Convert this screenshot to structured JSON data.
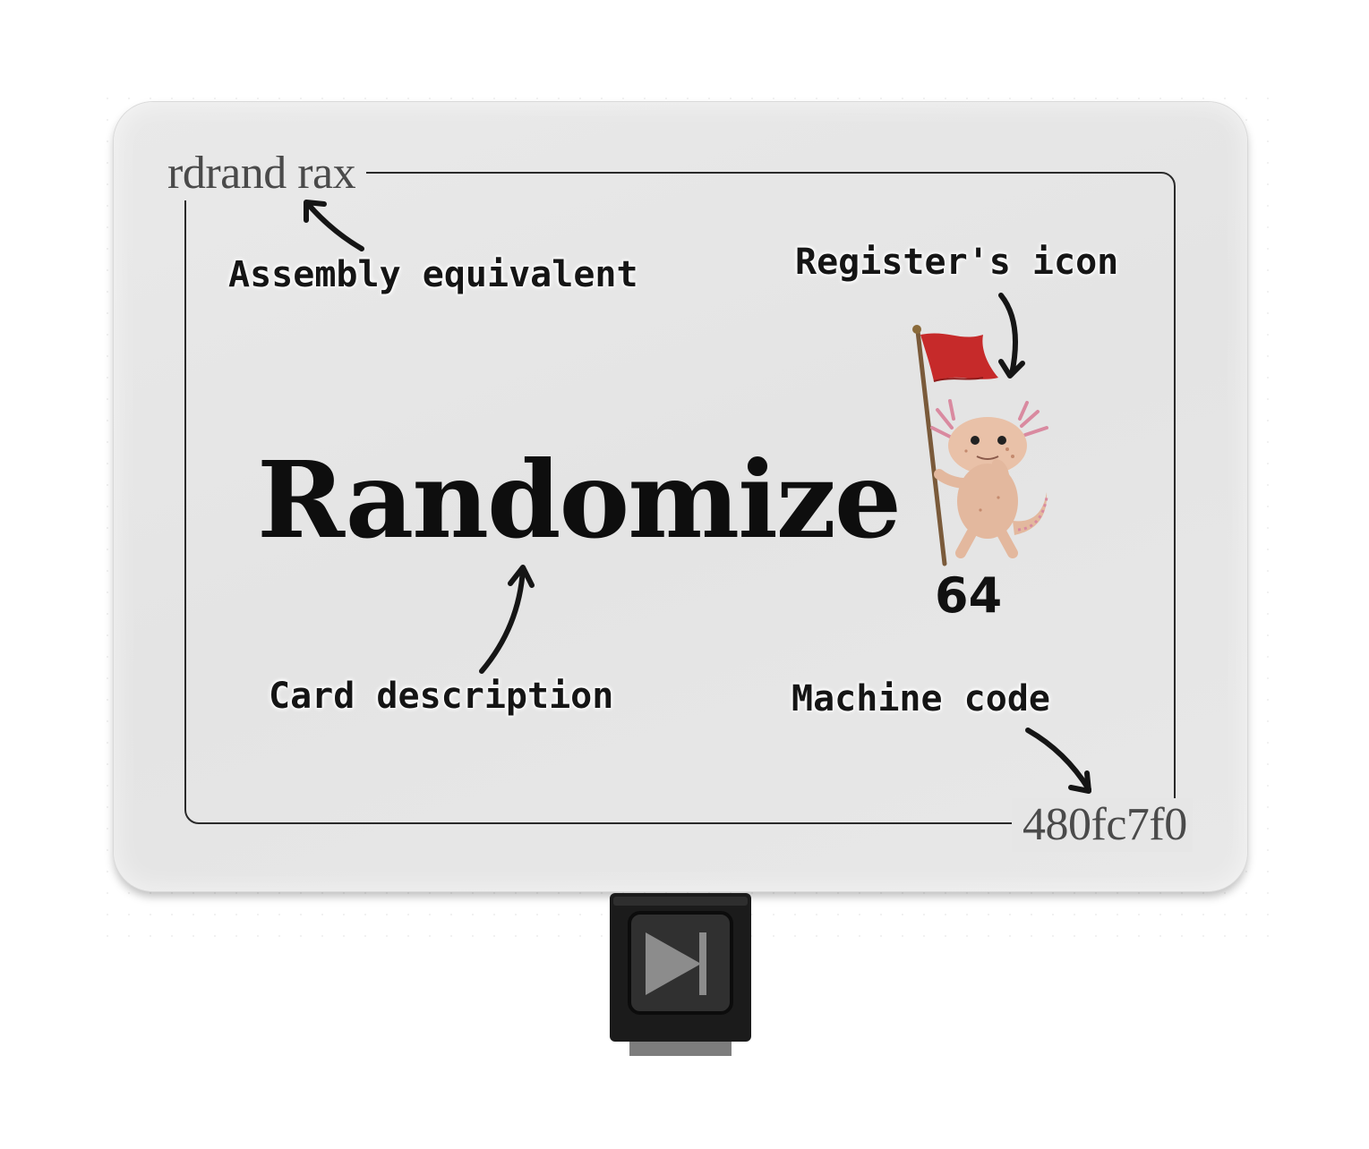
{
  "card": {
    "assembly": "rdrand rax",
    "description": "Randomize",
    "machine_code": "480fc7f0",
    "register_size": "64"
  },
  "annotations": {
    "assembly_label": "Assembly equivalent",
    "icon_label": "Register's icon",
    "description_label": "Card description",
    "machine_code_label": "Machine code"
  },
  "icons": {
    "register_icon": "axolotl-with-red-flag",
    "button_icon": "play-next-icon"
  },
  "colors": {
    "card_bg": "#e7e7e7",
    "flag_red": "#c62a2a",
    "axolotl_skin": "#e9c1a8",
    "button_dark": "#1b1b1b"
  }
}
